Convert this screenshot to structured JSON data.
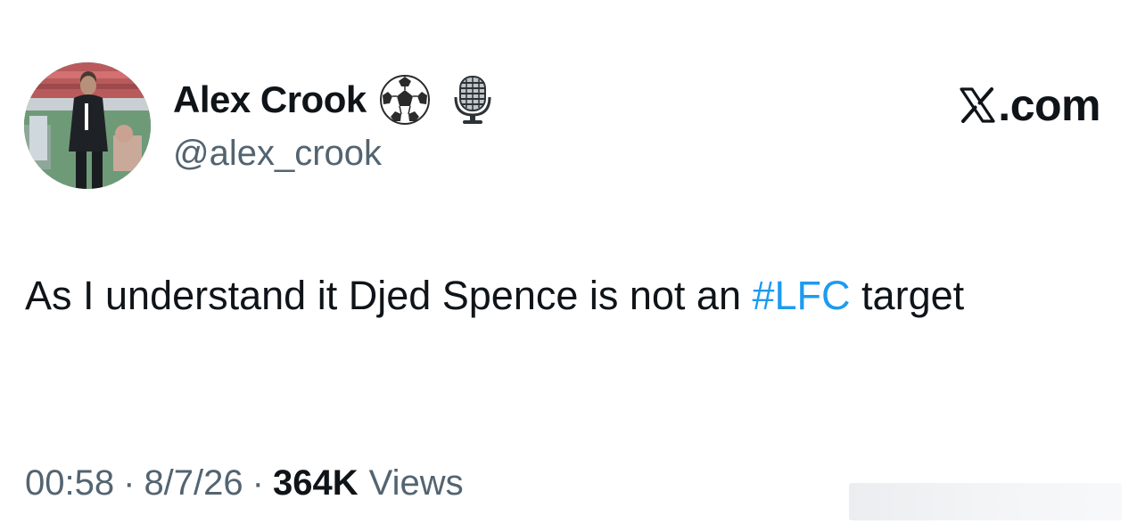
{
  "author": {
    "display_name": "Alex Crook",
    "handle": "@alex_crook",
    "badges": [
      "soccer-ball-icon",
      "microphone-icon"
    ]
  },
  "brand": {
    "text": ".com",
    "icon": "x-logo-icon"
  },
  "tweet": {
    "text_before": "As I understand it Djed Spence is not an ",
    "hashtag": "#LFC",
    "text_after": " target"
  },
  "meta": {
    "time": "00:58",
    "separator": "·",
    "date": "8/7/26",
    "views_count": "364K",
    "views_label": "Views"
  },
  "colors": {
    "text": "#0f1419",
    "secondary": "#536471",
    "link": "#1d9bf0"
  }
}
